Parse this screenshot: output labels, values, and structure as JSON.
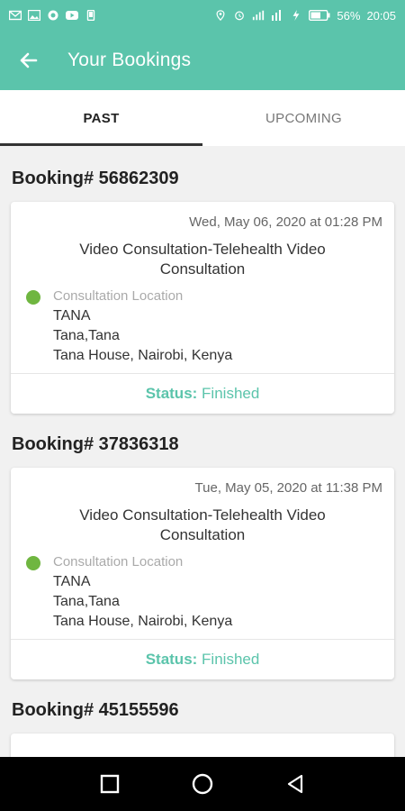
{
  "status_bar": {
    "battery": "56%",
    "time": "20:05",
    "left_icons": [
      "mail-icon",
      "image-icon",
      "circle-app-icon",
      "youtube-icon",
      "phone-icon"
    ],
    "right_icons": [
      "location-icon",
      "alarm-icon",
      "signal-icon",
      "wifi-icon",
      "charging-icon",
      "battery-icon"
    ]
  },
  "app_bar": {
    "title": "Your Bookings",
    "back_icon": "arrow-left-icon"
  },
  "tabs": [
    {
      "label": "PAST",
      "active": true
    },
    {
      "label": "UPCOMING",
      "active": false
    }
  ],
  "bookings": [
    {
      "title": "Booking# 56862309",
      "date": "Wed, May 06, 2020 at 01:28 PM",
      "service": "Video Consultation-Telehealth Video Consultation",
      "location_label": "Consultation Location",
      "location_lines": [
        "TANA",
        "Tana,Tana",
        "Tana House, Nairobi, Kenya"
      ],
      "status_label": "Status:",
      "status_value": "Finished"
    },
    {
      "title": "Booking# 37836318",
      "date": "Tue, May 05, 2020 at 11:38 PM",
      "service": "Video Consultation-Telehealth Video Consultation",
      "location_label": "Consultation Location",
      "location_lines": [
        "TANA",
        "Tana,Tana",
        "Tana House, Nairobi, Kenya"
      ],
      "status_label": "Status:",
      "status_value": "Finished"
    },
    {
      "title": "Booking# 45155596"
    }
  ],
  "colors": {
    "primary": "#5bc4ab",
    "location_dot": "#6fb640",
    "status": "#5bc4ab"
  },
  "nav_bar": {
    "icons": [
      "recents-square-icon",
      "home-circle-icon",
      "back-triangle-icon"
    ]
  }
}
